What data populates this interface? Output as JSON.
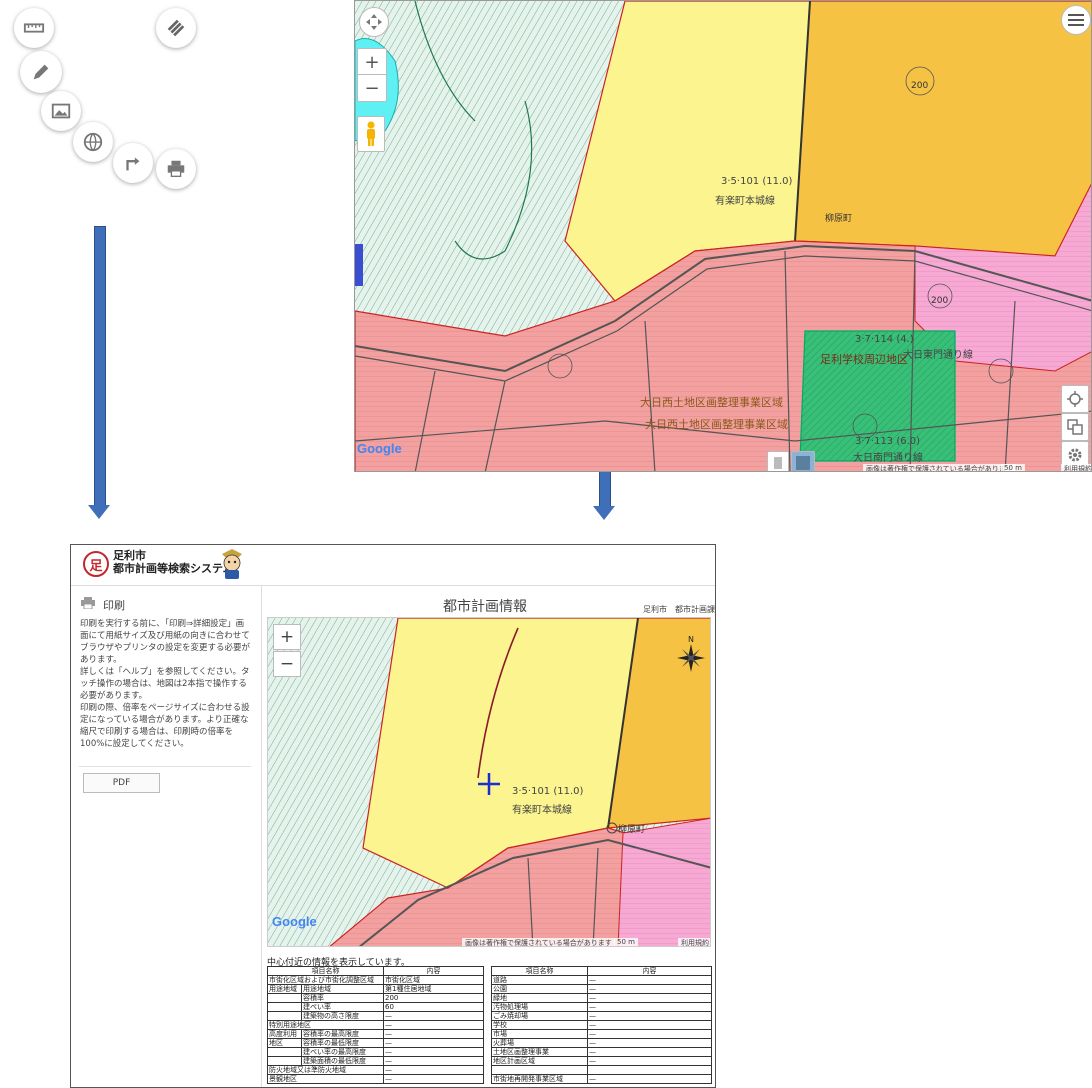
{
  "top_map": {
    "labels": {
      "route_main": "3·5·101 (11.0)",
      "route_main_name": "有楽町本城線",
      "honjo_street": "有楽町本城線",
      "yanagihara": "柳原町",
      "district_1": "大日西土地区画整理事業区域",
      "district_2": "大日西土地区画整理事業区域",
      "park_zone": "足利学校周辺地区",
      "route_south": "3·7·113 (6.0)",
      "route_south_name": "大日南門通り線",
      "route_east": "3·7·114 (4.)",
      "route_east_name": "大日東門通り線",
      "gov_1": "200",
      "gov_2": "200"
    },
    "google": "Google",
    "copyright": "画像は著作権で保護されている場合があります",
    "scale": "50 m",
    "terms": "利用規約"
  },
  "print_page": {
    "header": {
      "logo_mark": "足",
      "city": "足利市",
      "system": "都市計画等検索システム"
    },
    "sidebar": {
      "title": "印刷",
      "paragraphs": [
        "印刷を実行する前に、「印刷⇒詳細設定」画面にて用紙サイズ及び用紙の向きに合わせてブラウザやプリンタの設定を変更する必要があります。",
        "詳しくは「ヘルプ」を参照してください。タッチ操作の場合は、地図は2本指で操作する必要があります。",
        "印刷の際、倍率をページサイズに合わせる設定になっている場合があります。より正確な縮尺で印刷する場合は、印刷時の倍率を100%に設定してください。"
      ],
      "pdf_label": "PDF"
    },
    "title": "都市計画情報",
    "subtitle": "足利市　都市計画課",
    "map": {
      "zoom_in": "+",
      "zoom_out": "−",
      "route_label": "3·5·101 (11.0)",
      "route_name": "有楽町本城線",
      "yanagihara": "柳原町",
      "google": "Google",
      "copyright": "画像は著作権で保護されている場合があります",
      "scale": "50 m",
      "terms": "利用規約"
    },
    "info_caption": "中心付近の情報を表示しています。",
    "table_left": {
      "headers": [
        "項目名称",
        "内容"
      ],
      "rows": [
        {
          "c1": "市街化区域および市街化調整区域",
          "c2": "",
          "v": "市街化区域"
        },
        {
          "c1": "用途地域",
          "c2": "用途地域",
          "v": "第1種住居地域"
        },
        {
          "c1": "",
          "c2": "容積率",
          "v": "200"
        },
        {
          "c1": "",
          "c2": "建ぺい率",
          "v": "60"
        },
        {
          "c1": "",
          "c2": "建築物の高さ限度",
          "v": "—"
        },
        {
          "c1": "特別用途地区",
          "c2": "",
          "v": "—"
        },
        {
          "c1": "高度利用",
          "c2": "容積率の最高限度",
          "v": "—"
        },
        {
          "c1": "地区",
          "c2": "容積率の最低限度",
          "v": "—"
        },
        {
          "c1": "",
          "c2": "建ぺい率の最高限度",
          "v": "—"
        },
        {
          "c1": "",
          "c2": "建築面積の最低限度",
          "v": "—"
        },
        {
          "c1": "防火地域又は準防火地域",
          "c2": "",
          "v": "—"
        },
        {
          "c1": "景観地区",
          "c2": "",
          "v": "—"
        }
      ]
    },
    "table_right": {
      "headers": [
        "項目名称",
        "内容"
      ],
      "rows": [
        {
          "k": "道路",
          "v": "—"
        },
        {
          "k": "公園",
          "v": "—"
        },
        {
          "k": "緑地",
          "v": "—"
        },
        {
          "k": "汚物処理場",
          "v": "—"
        },
        {
          "k": "ごみ焼却場",
          "v": "—"
        },
        {
          "k": "学校",
          "v": "—"
        },
        {
          "k": "市場",
          "v": "—"
        },
        {
          "k": "火葬場",
          "v": "—"
        },
        {
          "k": "土地区画整理事業",
          "v": "—"
        },
        {
          "k": "地区計画区域",
          "v": "—"
        },
        {
          "k": "",
          "v": ""
        },
        {
          "k": "市街地再開発事業区域",
          "v": "—"
        }
      ]
    }
  }
}
